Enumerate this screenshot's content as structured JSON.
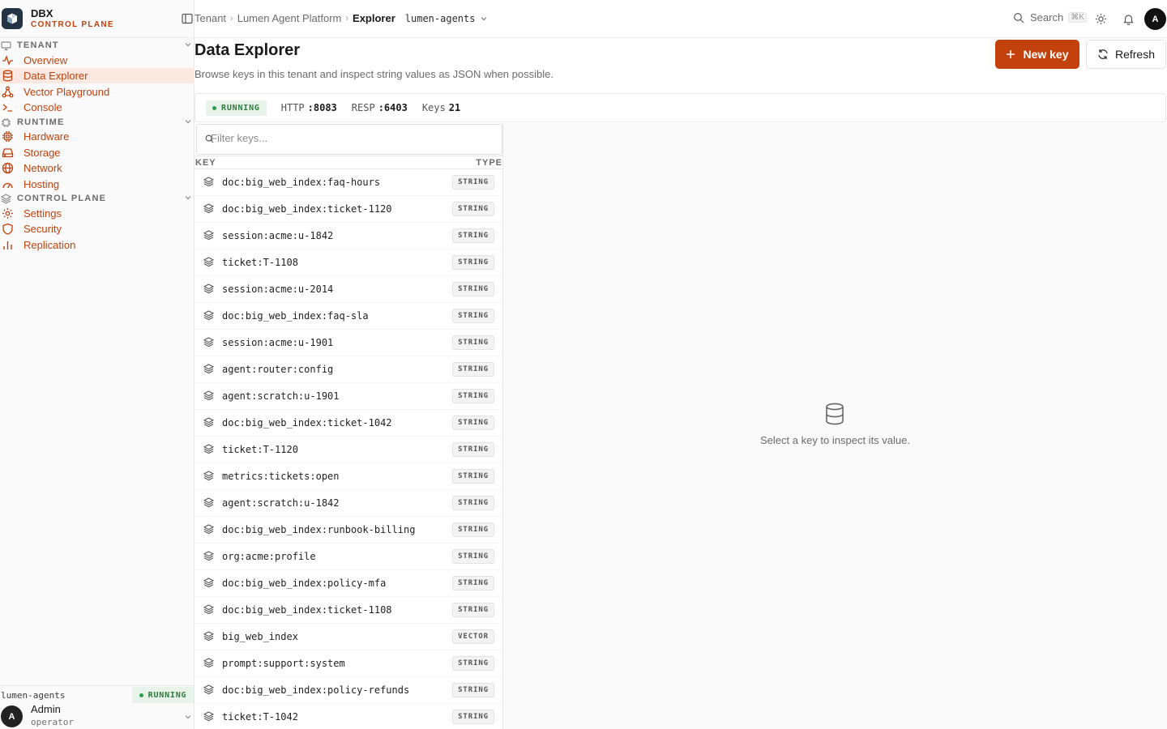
{
  "brand": {
    "title": "DBX",
    "subtitle": "CONTROL PLANE"
  },
  "sidebar": {
    "sections": [
      {
        "label": "TENANT",
        "items": [
          {
            "label": "Overview",
            "icon": "activity-icon",
            "active": false
          },
          {
            "label": "Data Explorer",
            "icon": "database-icon",
            "active": true
          },
          {
            "label": "Vector Playground",
            "icon": "network-nodes-icon",
            "active": false
          },
          {
            "label": "Console",
            "icon": "terminal-icon",
            "active": false
          }
        ]
      },
      {
        "label": "RUNTIME",
        "items": [
          {
            "label": "Hardware",
            "icon": "cpu-icon",
            "active": false
          },
          {
            "label": "Storage",
            "icon": "hard-drive-icon",
            "active": false
          },
          {
            "label": "Network",
            "icon": "globe-icon",
            "active": false
          },
          {
            "label": "Hosting",
            "icon": "gauge-icon",
            "active": false
          }
        ]
      },
      {
        "label": "CONTROL PLANE",
        "items": [
          {
            "label": "Settings",
            "icon": "gear-icon",
            "active": false
          },
          {
            "label": "Security",
            "icon": "shield-icon",
            "active": false
          },
          {
            "label": "Replication",
            "icon": "bar-chart-icon",
            "active": false
          }
        ]
      }
    ],
    "footer": {
      "tenant": "lumen-agents",
      "status": "RUNNING",
      "user_initial": "A",
      "user_name": "Admin",
      "user_role": "operator"
    }
  },
  "topbar": {
    "breadcrumbs": [
      "Tenant",
      "Lumen Agent Platform",
      "Explorer"
    ],
    "environment": "lumen-agents",
    "search_label": "Search",
    "search_shortcut": "⌘K",
    "avatar_initial": "A"
  },
  "page": {
    "title": "Data Explorer",
    "subtitle": "Browse keys in this tenant and inspect string values as JSON when possible.",
    "new_key_label": "New key",
    "refresh_label": "Refresh"
  },
  "status": {
    "state": "RUNNING",
    "http_label": "HTTP",
    "http_value": ":8083",
    "resp_label": "RESP",
    "resp_value": ":6403",
    "keys_label": "Keys",
    "keys_value": "21"
  },
  "keys": {
    "filter_placeholder": "Filter keys...",
    "col_key": "KEY",
    "col_type": "TYPE",
    "rows": [
      {
        "key": "doc:big_web_index:faq-hours",
        "type": "STRING"
      },
      {
        "key": "doc:big_web_index:ticket-1120",
        "type": "STRING"
      },
      {
        "key": "session:acme:u-1842",
        "type": "STRING"
      },
      {
        "key": "ticket:T-1108",
        "type": "STRING"
      },
      {
        "key": "session:acme:u-2014",
        "type": "STRING"
      },
      {
        "key": "doc:big_web_index:faq-sla",
        "type": "STRING"
      },
      {
        "key": "session:acme:u-1901",
        "type": "STRING"
      },
      {
        "key": "agent:router:config",
        "type": "STRING"
      },
      {
        "key": "agent:scratch:u-1901",
        "type": "STRING"
      },
      {
        "key": "doc:big_web_index:ticket-1042",
        "type": "STRING"
      },
      {
        "key": "ticket:T-1120",
        "type": "STRING"
      },
      {
        "key": "metrics:tickets:open",
        "type": "STRING"
      },
      {
        "key": "agent:scratch:u-1842",
        "type": "STRING"
      },
      {
        "key": "doc:big_web_index:runbook-billing",
        "type": "STRING"
      },
      {
        "key": "org:acme:profile",
        "type": "STRING"
      },
      {
        "key": "doc:big_web_index:policy-mfa",
        "type": "STRING"
      },
      {
        "key": "doc:big_web_index:ticket-1108",
        "type": "STRING"
      },
      {
        "key": "big_web_index",
        "type": "VECTOR"
      },
      {
        "key": "prompt:support:system",
        "type": "STRING"
      },
      {
        "key": "doc:big_web_index:policy-refunds",
        "type": "STRING"
      },
      {
        "key": "ticket:T-1042",
        "type": "STRING"
      }
    ]
  },
  "detail": {
    "empty_text": "Select a key to inspect its value."
  },
  "colors": {
    "accent": "#c2410c",
    "running": "#2e7d3e",
    "running_bg": "#e8f3ea",
    "active_bg": "#fbe8e0"
  }
}
